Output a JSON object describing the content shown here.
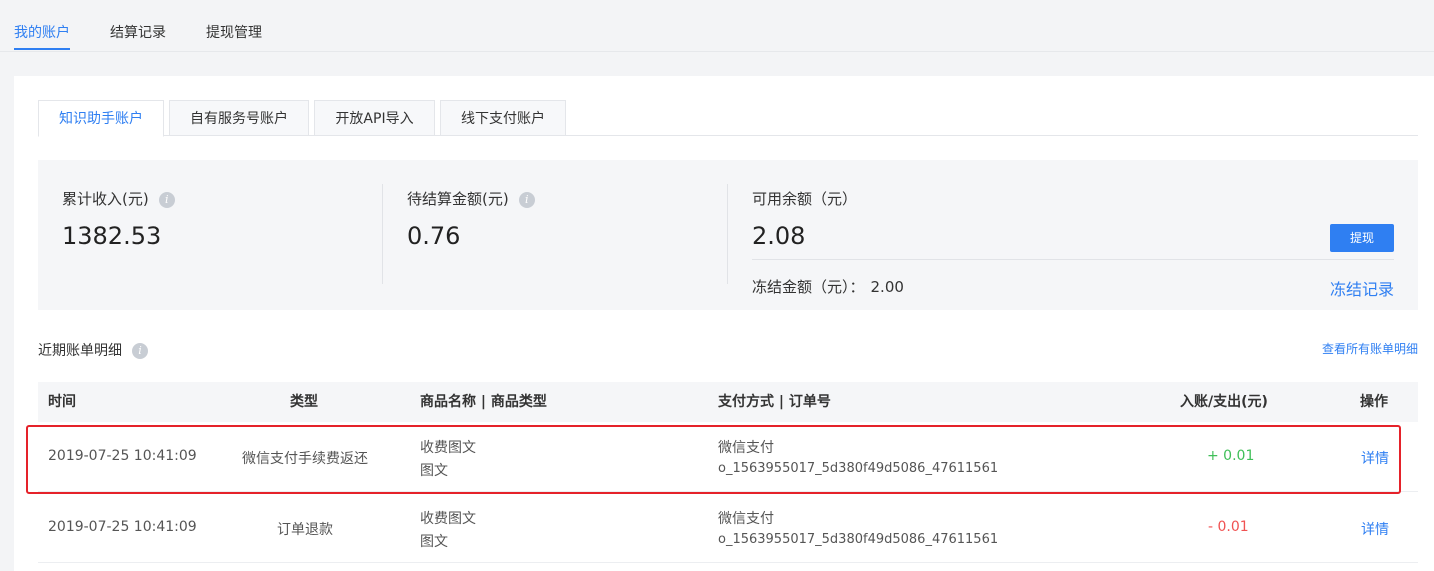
{
  "top_tabs": [
    "我的账户",
    "结算记录",
    "提现管理"
  ],
  "account_tabs": [
    "知识助手账户",
    "自有服务号账户",
    "开放API导入",
    "线下支付账户"
  ],
  "summary": {
    "total_income_label": "累计收入(元)",
    "total_income_value": "1382.53",
    "pending_label": "待结算金额(元)",
    "pending_value": "0.76",
    "available_label": "可用余额（元）",
    "available_value": "2.08",
    "withdraw_button": "提现",
    "frozen_label": "冻结金额（元）：",
    "frozen_value": "2.00",
    "frozen_link": "冻结记录"
  },
  "recent": {
    "title": "近期账单明细",
    "view_all": "查看所有账单明细"
  },
  "table": {
    "headers": [
      "时间",
      "类型",
      "商品名称 | 商品类型",
      "支付方式 | 订单号",
      "入账/支出(元)",
      "操作"
    ],
    "rows": [
      {
        "time": "2019-07-25 10:41:09",
        "type": "微信支付手续费返还",
        "product_name": "收费图文",
        "product_type": "图文",
        "pay_method": "微信支付",
        "order_no": "o_1563955017_5d380f49d5086_47611561",
        "amount": "+ 0.01",
        "action": "详情"
      },
      {
        "time": "2019-07-25 10:41:09",
        "type": "订单退款",
        "product_name": "收费图文",
        "product_type": "图文",
        "pay_method": "微信支付",
        "order_no": "o_1563955017_5d380f49d5086_47611561",
        "amount": "- 0.01",
        "action": "详情"
      }
    ]
  },
  "colors": {
    "accent": "#2f7ff2",
    "positive": "#3fbf58",
    "negative": "#f05252",
    "highlight_border": "#e5222a"
  },
  "icons": {
    "info": "info-icon"
  }
}
